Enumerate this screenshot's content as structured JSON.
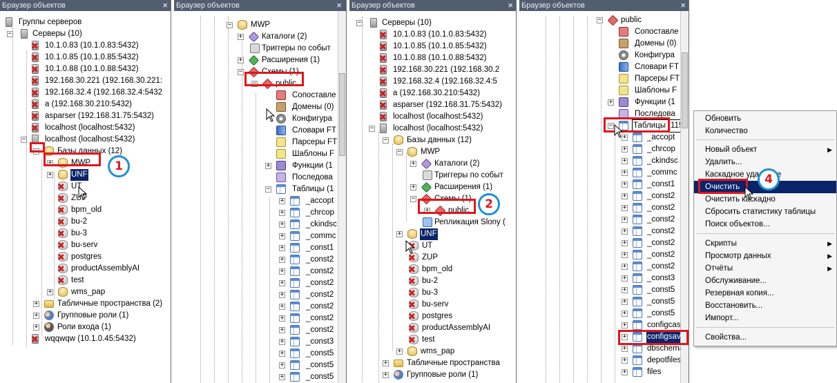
{
  "panel_title": "Браузер объектов",
  "close_glyph": "×",
  "panel1": {
    "rows": [
      {
        "label": "Группы серверов",
        "icon": "server-group-icon"
      },
      {
        "label": "Серверы (10)",
        "icon": "servers-icon"
      },
      {
        "label": "10.1.0.83 (10.1.0.83:5432)"
      },
      {
        "label": "10.1.0.85 (10.1.0.85:5432)"
      },
      {
        "label": "10.1.0.88 (10.1.0.88:5432)"
      },
      {
        "label": "192.168.30.221 (192.168.30.221:"
      },
      {
        "label": "192.168.32.4 (192.168.32.4:5432"
      },
      {
        "label": "a (192.168.30.210:5432)"
      },
      {
        "label": "asparser (192.168.31.75:5432)"
      },
      {
        "label": "localhost (localhost:5432)"
      },
      {
        "label": "localhost (localhost:5432)"
      },
      {
        "label": "Базы данных (12)"
      },
      {
        "label": "MWP"
      },
      {
        "label": "UNF"
      },
      {
        "label": "UT"
      },
      {
        "label": "ZUP"
      },
      {
        "label": "bpm_old"
      },
      {
        "label": "bu-2"
      },
      {
        "label": "bu-3"
      },
      {
        "label": "bu-serv"
      },
      {
        "label": "postgres"
      },
      {
        "label": "productAssemblyAI"
      },
      {
        "label": "test"
      },
      {
        "label": "wms_pap"
      },
      {
        "label": "Табличные пространства (2)"
      },
      {
        "label": "Групповые роли (1)"
      },
      {
        "label": "Роли входа (1)"
      },
      {
        "label": "wqqwqw (10.1.0.45:5432)"
      }
    ],
    "step": "1"
  },
  "panel2": {
    "rows": [
      {
        "label": "MWP"
      },
      {
        "label": "Каталоги (2)"
      },
      {
        "label": "Триггеры по событ"
      },
      {
        "label": "Расширения (1)"
      },
      {
        "label": "Схемы (1)"
      },
      {
        "label": "public"
      },
      {
        "label": "Сопоставле"
      },
      {
        "label": "Домены (0)"
      },
      {
        "label": "Конфигура"
      },
      {
        "label": "Словари FT"
      },
      {
        "label": "Парсеры FT"
      },
      {
        "label": "Шаблоны F"
      },
      {
        "label": "Функции (1"
      },
      {
        "label": "Последова"
      },
      {
        "label": "Таблицы (1"
      },
      {
        "label": "_accopt"
      },
      {
        "label": "_chrcop"
      },
      {
        "label": "_ckindsc"
      },
      {
        "label": "_commc"
      },
      {
        "label": "_const1"
      },
      {
        "label": "_const2"
      },
      {
        "label": "_const2"
      },
      {
        "label": "_const2"
      },
      {
        "label": "_const2"
      },
      {
        "label": "_const2"
      },
      {
        "label": "_const3"
      },
      {
        "label": "_const5"
      },
      {
        "label": "_const5"
      }
    ]
  },
  "panel3": {
    "rows": [
      {
        "label": "Серверы (10)"
      },
      {
        "label": "10.1.0.83 (10.1.0.83:5432)"
      },
      {
        "label": "10.1.0.85 (10.1.0.85:5432)"
      },
      {
        "label": "10.1.0.88 (10.1.0.88:5432)"
      },
      {
        "label": "192.168.30.221 (192.168.30.2"
      },
      {
        "label": "192.168.32.4 (192.168.32.4:5"
      },
      {
        "label": "a (192.168.30.210:5432)"
      },
      {
        "label": "asparser (192.168.31.75:5432)"
      },
      {
        "label": "localhost (localhost:5432)"
      },
      {
        "label": "localhost (localhost:5432)"
      },
      {
        "label": "Базы данных (12)"
      },
      {
        "label": "MWP"
      },
      {
        "label": "Каталоги (2)"
      },
      {
        "label": "Триггеры по событ"
      },
      {
        "label": "Расширения (1)"
      },
      {
        "label": "Схемы (1)"
      },
      {
        "label": "public"
      },
      {
        "label": "Репликация Slony ("
      },
      {
        "label": "UNF"
      },
      {
        "label": "UT"
      },
      {
        "label": "ZUP"
      },
      {
        "label": "bpm_old"
      },
      {
        "label": "bu-2"
      },
      {
        "label": "bu-3"
      },
      {
        "label": "bu-serv"
      },
      {
        "label": "postgres"
      },
      {
        "label": "productAssemblyAI"
      },
      {
        "label": "test"
      },
      {
        "label": "wms_pap"
      },
      {
        "label": "Табличные пространства"
      },
      {
        "label": "Групповые роли (1)"
      }
    ],
    "step": "2"
  },
  "panel4": {
    "rows": [
      {
        "label": "public"
      },
      {
        "label": "Сопоставле"
      },
      {
        "label": "Домены (0)"
      },
      {
        "label": "Конфигура"
      },
      {
        "label": "Словари FT"
      },
      {
        "label": "Парсеры FT"
      },
      {
        "label": "Шаблоны F"
      },
      {
        "label": "Функции (1"
      },
      {
        "label": "Последова"
      },
      {
        "label": "Таблицы (115)"
      },
      {
        "label": "_accopt"
      },
      {
        "label": "_chrcop"
      },
      {
        "label": "_ckindsc"
      },
      {
        "label": "_commc"
      },
      {
        "label": "_const1"
      },
      {
        "label": "_const2"
      },
      {
        "label": "_const2"
      },
      {
        "label": "_const2"
      },
      {
        "label": "_const2"
      },
      {
        "label": "_const2"
      },
      {
        "label": "_const2"
      },
      {
        "label": "_const2"
      },
      {
        "label": "_const3"
      },
      {
        "label": "_const5"
      },
      {
        "label": "_const5"
      },
      {
        "label": "_const5"
      },
      {
        "label": "configcassa"
      },
      {
        "label": "configsave"
      },
      {
        "label": "dbschema"
      },
      {
        "label": "depotfiles"
      },
      {
        "label": "files"
      }
    ],
    "step": "3"
  },
  "context_menu": {
    "items": [
      {
        "label": "Обновить"
      },
      {
        "label": "Количество"
      },
      {
        "label": "Новый объект",
        "submenu": true
      },
      {
        "label": "Удалить..."
      },
      {
        "label": "Каскадное удаление"
      },
      {
        "label": "Очистить",
        "highlighted": true
      },
      {
        "label": "Очистить каскадно"
      },
      {
        "label": "Сбросить статистику таблицы"
      },
      {
        "label": "Поиск объектов..."
      },
      {
        "label": "Скрипты",
        "submenu": true
      },
      {
        "label": "Просмотр данных",
        "submenu": true
      },
      {
        "label": "Отчёты",
        "submenu": true
      },
      {
        "label": "Обслуживание..."
      },
      {
        "label": "Резервная копия..."
      },
      {
        "label": "Восстановить..."
      },
      {
        "label": "Импорт..."
      },
      {
        "label": "Свойства..."
      }
    ],
    "submenu_arrow": "▶",
    "step": "4"
  },
  "expand_glyph": "+",
  "collapse_glyph": "−",
  "colors": {
    "highlight": "#e0161c",
    "badge_ring": "#1e8fd8",
    "selection": "#0a246a",
    "titlebar": "#515e70"
  }
}
